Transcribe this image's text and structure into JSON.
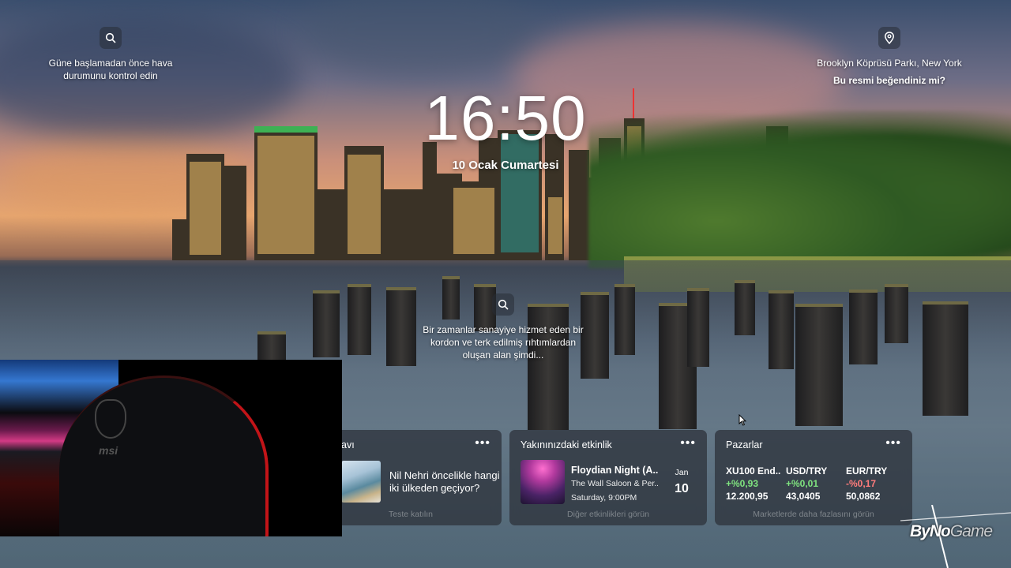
{
  "weather_hint": {
    "icon": "search-icon",
    "text": "Güne başlamadan önce hava durumunu kontrol edin"
  },
  "location": {
    "icon": "location-pin-icon",
    "place": "Brooklyn Köprüsü Parkı, New York",
    "like_prompt": "Bu resmi beğendiniz mi?"
  },
  "clock": {
    "time": "16:50",
    "date": "10 Ocak Cumartesi"
  },
  "photo_info": {
    "icon": "search-icon",
    "text": "Bir zamanlar sanayiye hizmet eden bir kordon ve terk edilmiş rıhtımlardan oluşan alan şimdi..."
  },
  "quiz_card": {
    "title_partial": "avı",
    "more": "•••",
    "question": "Nil Nehri öncelikle hangi iki ülkeden geçiyor?",
    "footer": "Teste katılın"
  },
  "events_card": {
    "title": "Yakınınızdaki etkinlik",
    "more": "•••",
    "event_title": "Floydian Night (A...",
    "event_venue": "The Wall Saloon & Per...",
    "event_time": "Saturday, 9:00PM",
    "event_month": "Jan",
    "event_day": "10",
    "footer": "Diğer etkinlikleri görün"
  },
  "markets_card": {
    "title": "Pazarlar",
    "more": "•••",
    "items": [
      {
        "name": "XU100 End...",
        "change": "+%0,93",
        "direction": "up",
        "value": "12.200,95"
      },
      {
        "name": "USD/TRY",
        "change": "+%0,01",
        "direction": "up",
        "value": "43,0405"
      },
      {
        "name": "EUR/TRY",
        "change": "-%0,17",
        "direction": "down",
        "value": "50,0862"
      }
    ],
    "footer": "Marketlerde daha fazlasını görün"
  },
  "watermark": {
    "brand_a": "ByNo",
    "brand_b": "Game"
  },
  "colors": {
    "card_bg": "#30363e",
    "up": "#7fe37f",
    "down": "#ff7c7c",
    "chair_accent": "#c21418"
  }
}
